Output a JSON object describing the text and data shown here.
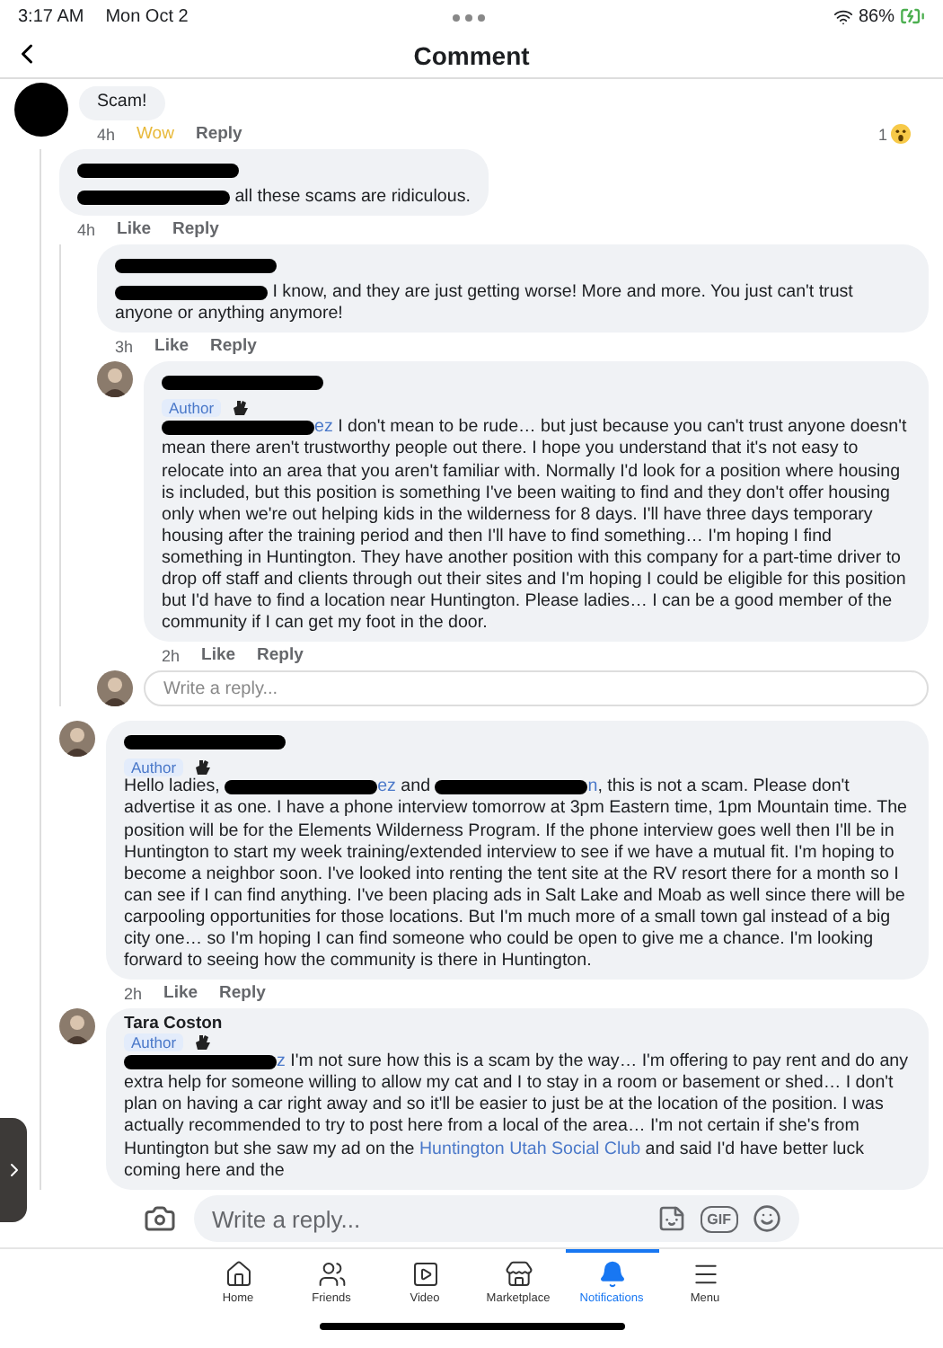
{
  "status_bar": {
    "time": "3:17 AM",
    "date": "Mon Oct 2",
    "battery": "86%"
  },
  "header": {
    "title": "Comment"
  },
  "comments": [
    {
      "segments": [
        {
          "kind": "text",
          "text": "Scam!"
        }
      ],
      "time": "4h",
      "actions": [
        {
          "label": "Wow",
          "reacted": true
        },
        {
          "label": "Reply",
          "reacted": false
        }
      ],
      "reaction_count": "1",
      "children": [
        {
          "name": {
            "kind": "redacted"
          },
          "segments": [
            {
              "kind": "redacted"
            },
            {
              "kind": "text",
              "text": " all these scams are ridiculous."
            }
          ],
          "time": "4h",
          "actions": [
            {
              "label": "Like",
              "reacted": false
            },
            {
              "label": "Reply",
              "reacted": false
            }
          ],
          "children": [
            {
              "name": {
                "kind": "redacted"
              },
              "segments": [
                {
                  "kind": "redacted"
                },
                {
                  "kind": "text",
                  "text": " I know, and they are just getting worse! More and more. You just can't trust anyone or anything anymore!"
                }
              ],
              "time": "3h",
              "actions": [
                {
                  "label": "Like",
                  "reacted": false
                },
                {
                  "label": "Reply",
                  "reacted": false
                }
              ]
            },
            {
              "name": {
                "kind": "redacted"
              },
              "author_label": "Author",
              "segments": [
                {
                  "kind": "redacted"
                },
                {
                  "kind": "link",
                  "text": "ez"
                },
                {
                  "kind": "text",
                  "text": " I don't mean to be rude… but just because you can't trust anyone doesn't mean there aren't trustworthy people out there.  I hope you understand that it's not easy to relocate into an area that you aren't familiar with.  Normally I'd look for a position where housing is included, but this position is something I've been waiting to find and they don't offer housing only when we're out helping kids in the wilderness for 8 days.  I'll have three days temporary housing after the training period and then I'll have to find something… I'm hoping I find something in Huntington.  They have another position with this company for a part-time driver to drop off staff and clients through out their sites and I'm hoping I could be eligible for this position but I'd have to find a location near Huntington.  Please ladies… I can be a good member of the community if I can get my foot in the door."
                }
              ],
              "time": "2h",
              "actions": [
                {
                  "label": "Like",
                  "reacted": false
                },
                {
                  "label": "Reply",
                  "reacted": false
                }
              ]
            }
          ],
          "reply_placeholder": "Write a reply..."
        },
        {
          "name": {
            "kind": "redacted"
          },
          "author_label": "Author",
          "segments": [
            {
              "kind": "text",
              "text": "Hello ladies, "
            },
            {
              "kind": "redacted"
            },
            {
              "kind": "link",
              "text": "ez"
            },
            {
              "kind": "text",
              "text": " and "
            },
            {
              "kind": "redacted"
            },
            {
              "kind": "link",
              "text": "n"
            },
            {
              "kind": "text",
              "text": ", this is not a scam.  Please don't advertise it as one.  I have a phone interview tomorrow at 3pm Eastern time, 1pm Mountain time.  The position will be for the Elements Wilderness Program.  If the phone interview goes well then I'll be in Huntington to start my week training/extended interview to see if we have a mutual fit.  I'm hoping to become a neighbor soon.  I've looked into renting the tent site at the RV resort there for a month so I can see if I can find anything.  I've been placing ads in Salt Lake and Moab as well since there will be carpooling opportunities for those locations.  But I'm much more of a small town gal instead of a big city one… so I'm hoping I can find someone who could be open to give me a chance.  I'm looking forward to seeing how the community is there in Huntington."
            }
          ],
          "time": "2h",
          "actions": [
            {
              "label": "Like",
              "reacted": false
            },
            {
              "label": "Reply",
              "reacted": false
            }
          ]
        },
        {
          "name": {
            "kind": "text",
            "text": "Tara Coston"
          },
          "author_label": "Author",
          "segments": [
            {
              "kind": "redacted"
            },
            {
              "kind": "link",
              "text": "z"
            },
            {
              "kind": "text",
              "text": " I'm not sure how this is a scam by the way… I'm offering to pay rent and do any extra help for someone willing to allow my cat and I to stay in a room or basement or shed… I don't plan on having a car right away and so it'll be easier to just be at the location of the position.  I was actually recommended to try to post here from a local of the area… I'm not certain if she's from Huntington but she saw my ad on the "
            },
            {
              "kind": "link",
              "text": "Huntington Utah Social Club"
            },
            {
              "kind": "text",
              "text": " and said I'd have better luck coming here and the"
            }
          ]
        }
      ]
    }
  ],
  "composer": {
    "placeholder": "Write a reply...",
    "gif_label": "GIF"
  },
  "tab_bar": [
    {
      "label": "Home",
      "selected": false
    },
    {
      "label": "Friends",
      "selected": false
    },
    {
      "label": "Video",
      "selected": false
    },
    {
      "label": "Marketplace",
      "selected": false
    },
    {
      "label": "Notifications",
      "selected": true
    },
    {
      "label": "Menu",
      "selected": false
    }
  ]
}
